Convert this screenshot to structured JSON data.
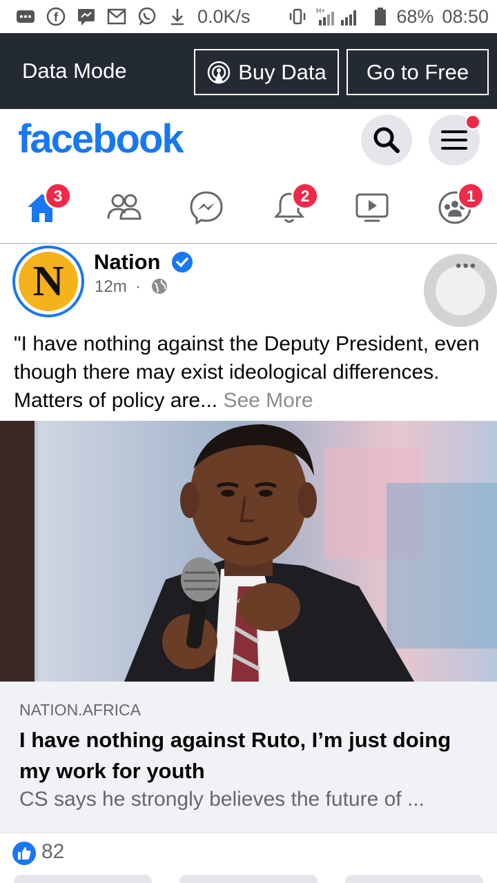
{
  "status_bar": {
    "net_speed": "0.0K/s",
    "battery": "68%",
    "time": "08:50",
    "network_type": "H+"
  },
  "data_bar": {
    "title": "Data Mode",
    "buy_label": "Buy Data",
    "free_label": "Go to Free"
  },
  "header": {
    "logo": "facebook"
  },
  "nav": {
    "home_badge": "3",
    "notifications_badge": "2",
    "groups_badge": "1"
  },
  "post": {
    "page_name": "Nation",
    "time": "12m",
    "separator": "·",
    "text": "\"I have nothing against the Deputy President, even though there may exist ideological differences. Matters of policy are...",
    "see_more": "See More",
    "link": {
      "domain": "NATION.AFRICA",
      "title": "I have nothing against Ruto, I’m just doing my work for youth",
      "subtitle": "CS says he strongly believes the future of ..."
    },
    "reaction_count": "82"
  },
  "colors": {
    "brand": "#1877f2",
    "badge": "#f02849",
    "data_bar_bg": "#242a33"
  }
}
